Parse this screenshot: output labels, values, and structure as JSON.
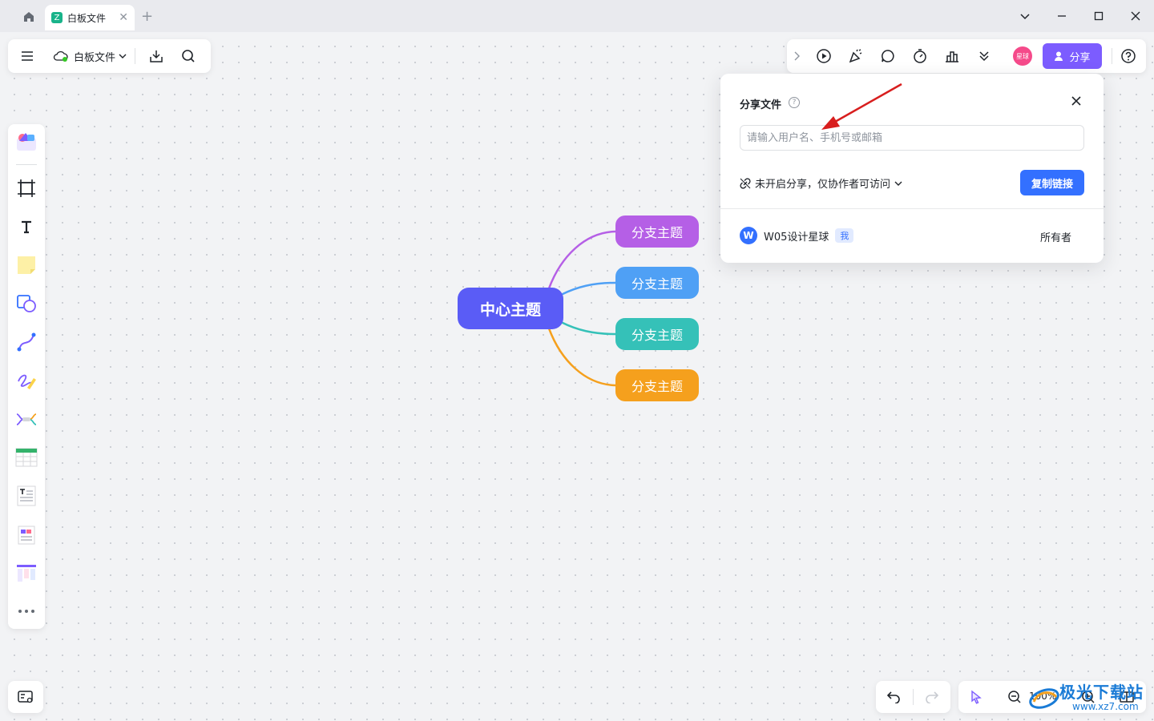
{
  "titlebar": {
    "tab_title": "白板文件",
    "tab_icon_char": "Z"
  },
  "toolbar_left": {
    "file_name": "白板文件"
  },
  "toolbar_right": {
    "avatar_label": "星球",
    "share_label": "分享"
  },
  "mindmap": {
    "central": "中心主题",
    "branches": [
      {
        "label": "分支主题",
        "color": "#b55fe6"
      },
      {
        "label": "分支主题",
        "color": "#4fa0f5"
      },
      {
        "label": "分支主题",
        "color": "#35c1b8"
      },
      {
        "label": "分支主题",
        "color": "#f5a01d"
      }
    ],
    "central_color": "#5a5cf6"
  },
  "share_popover": {
    "title": "分享文件",
    "input_placeholder": "请输入用户名、手机号或邮箱",
    "permission_text": "未开启分享，仅协作者可访问",
    "copy_link_label": "复制链接",
    "user": {
      "avatar_letter": "W",
      "name": "W05设计星球",
      "me_tag": "我",
      "role": "所有者"
    }
  },
  "zoom": {
    "level": "100%"
  },
  "watermark": {
    "line1": "极光下载站",
    "line2": "www.xz7.com"
  },
  "colors": {
    "accent_purple": "#7c5cff",
    "primary_blue": "#3370ff",
    "arrow_red": "#d81e1e"
  }
}
